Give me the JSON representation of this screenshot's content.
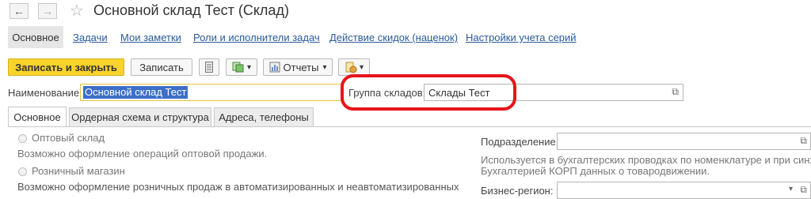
{
  "window": {
    "title": "Основной склад Тест (Склад)",
    "back_glyph": "←",
    "forward_glyph": "→",
    "star_glyph": "☆"
  },
  "nav_tabs": [
    {
      "label": "Основное"
    },
    {
      "label": "Задачи"
    },
    {
      "label": "Мои заметки"
    },
    {
      "label": "Роли и исполнители задач"
    },
    {
      "label": "Действие скидок (наценок)"
    },
    {
      "label": "Настройки учета серий"
    }
  ],
  "toolbar": {
    "save_close": "Записать и закрыть",
    "save": "Записать",
    "reports": "Отчеты",
    "dropdown_glyph": "▾"
  },
  "form": {
    "name_label": "Наименование:",
    "name_value": "Основной склад Тест",
    "group_label": "Группа складов:",
    "group_value": "Склады Тест",
    "open_glyph": "⧉"
  },
  "inner_tabs": [
    {
      "label": "Основное"
    },
    {
      "label": "Ордерная схема и структура"
    },
    {
      "label": "Адреса, телефоны"
    }
  ],
  "content": {
    "wholesale_label": "Оптовый склад",
    "wholesale_desc": "Возможно оформление операций оптовой продажи.",
    "retail_label": "Розничный магазин",
    "retail_desc": "Возможно оформление розничных продаж в автоматизированных и неавтоматизированных",
    "division_label": "Подразделение:",
    "division_note_1": "Используется в бухгалтерских проводках по номенклатуре и при синхрон",
    "division_note_2": "Бухгалтерией КОРП данных о товародвижении.",
    "region_label": "Бизнес-регион:"
  },
  "colors": {
    "primary_button": "#f8d32b",
    "highlight_circle": "#e8141b",
    "link": "#2a5b9a",
    "selection": "#3d6fc8"
  }
}
